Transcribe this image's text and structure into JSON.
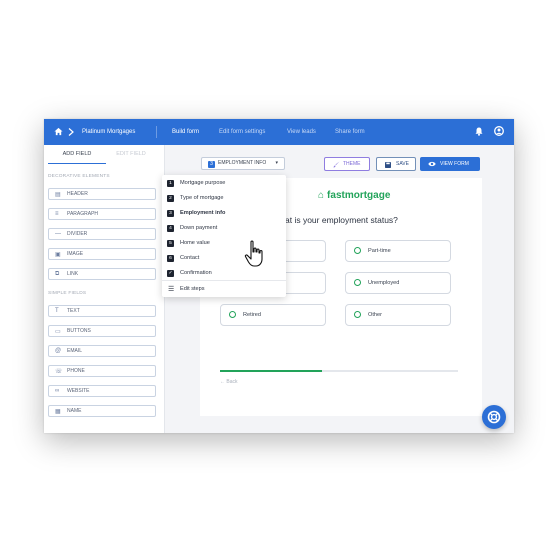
{
  "topbar": {
    "workspace": "Platinum Mortgages",
    "nav": [
      "Build form",
      "Edit form settings",
      "View leads",
      "Share form"
    ]
  },
  "sidebar": {
    "tabs": [
      "ADD FIELD",
      "EDIT FIELD"
    ],
    "decorative_heading": "DECORATIVE ELEMENTS",
    "decorative_items": [
      {
        "label": "HEADER",
        "icon": "header-icon"
      },
      {
        "label": "PARAGRAPH",
        "icon": "paragraph-icon"
      },
      {
        "label": "DIVIDER",
        "icon": "divider-icon"
      },
      {
        "label": "IMAGE",
        "icon": "image-icon"
      },
      {
        "label": "LINK",
        "icon": "link-icon"
      }
    ],
    "simple_heading": "SIMPLE FIELDS",
    "simple_items": [
      {
        "label": "TEXT",
        "icon": "text-icon"
      },
      {
        "label": "BUTTONS",
        "icon": "buttons-icon"
      },
      {
        "label": "EMAIL",
        "icon": "email-icon"
      },
      {
        "label": "PHONE",
        "icon": "phone-icon"
      },
      {
        "label": "WEBSITE",
        "icon": "website-icon"
      },
      {
        "label": "NAME",
        "icon": "name-icon"
      }
    ]
  },
  "toolbar": {
    "step_number": "3",
    "step_label": "EMPLOYMENT INFO",
    "theme_label": "THEME",
    "save_label": "SAVE",
    "view_label": "VIEW FORM"
  },
  "form": {
    "brand": "fastmortgage",
    "question": "at is your employment status?",
    "options": [
      "",
      "Part-time",
      "",
      "Unemployed",
      "Retired",
      "Other"
    ],
    "progress": 0.43,
    "back": "← Back"
  },
  "dropdown": {
    "steps": [
      {
        "num": "1",
        "label": "Mortgage purpose"
      },
      {
        "num": "2",
        "label": "Type of mortgage"
      },
      {
        "num": "3",
        "label": "Employment info",
        "active": true
      },
      {
        "num": "4",
        "label": "Down payment"
      },
      {
        "num": "5",
        "label": "Home value"
      },
      {
        "num": "6",
        "label": "Contact"
      },
      {
        "num": "✓",
        "label": "Confirmation"
      }
    ],
    "edit_label": "Edit steps"
  },
  "colors": {
    "accent": "#2c6fd6",
    "brand_green": "#22a35a",
    "theme_purple": "#8f7de0"
  }
}
